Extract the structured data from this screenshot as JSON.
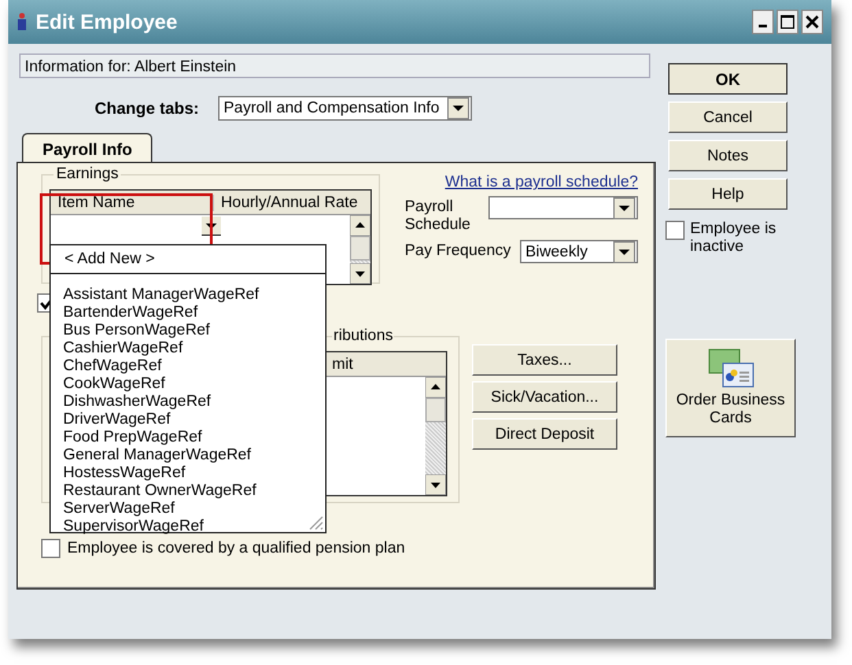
{
  "window": {
    "title": "Edit Employee"
  },
  "info": "Information for: Albert Einstein",
  "change_tabs": {
    "label": "Change tabs:",
    "value": "Payroll and Compensation Info"
  },
  "tabs": [
    {
      "label": "Payroll Info",
      "selected": true
    }
  ],
  "earnings": {
    "title": "Earnings",
    "columns": [
      "Item Name",
      "Hourly/Annual Rate"
    ]
  },
  "hidden_checkbox": {
    "checked": true
  },
  "schedule_link": "What is a payroll schedule?",
  "payroll_schedule": {
    "label": "Payroll Schedule"
  },
  "pay_frequency": {
    "label": "Pay Frequency",
    "value": "Biweekly"
  },
  "distributions": {
    "title": "ributions",
    "columns": [
      "mit"
    ]
  },
  "side_buttons": [
    "Taxes...",
    "Sick/Vacation...",
    "Direct Deposit"
  ],
  "pension": {
    "label": "Employee is covered by a qualified pension plan",
    "checked": false
  },
  "dropdown": {
    "add_new": "< Add New >",
    "items": [
      "Assistant ManagerWageRef",
      "BartenderWageRef",
      "Bus PersonWageRef",
      "CashierWageRef",
      "ChefWageRef",
      "CookWageRef",
      "DishwasherWageRef",
      "DriverWageRef",
      "Food PrepWageRef",
      "General ManagerWageRef",
      "HostessWageRef",
      "Restaurant OwnerWageRef",
      "ServerWageRef",
      "SupervisorWageRef"
    ]
  },
  "actions": [
    {
      "label": "OK",
      "default": true
    },
    {
      "label": "Cancel",
      "default": false
    },
    {
      "label": "Notes",
      "default": false
    },
    {
      "label": "Help",
      "default": false
    }
  ],
  "inactive": {
    "label": "Employee is inactive",
    "checked": false
  },
  "order_cards": "Order Business Cards"
}
